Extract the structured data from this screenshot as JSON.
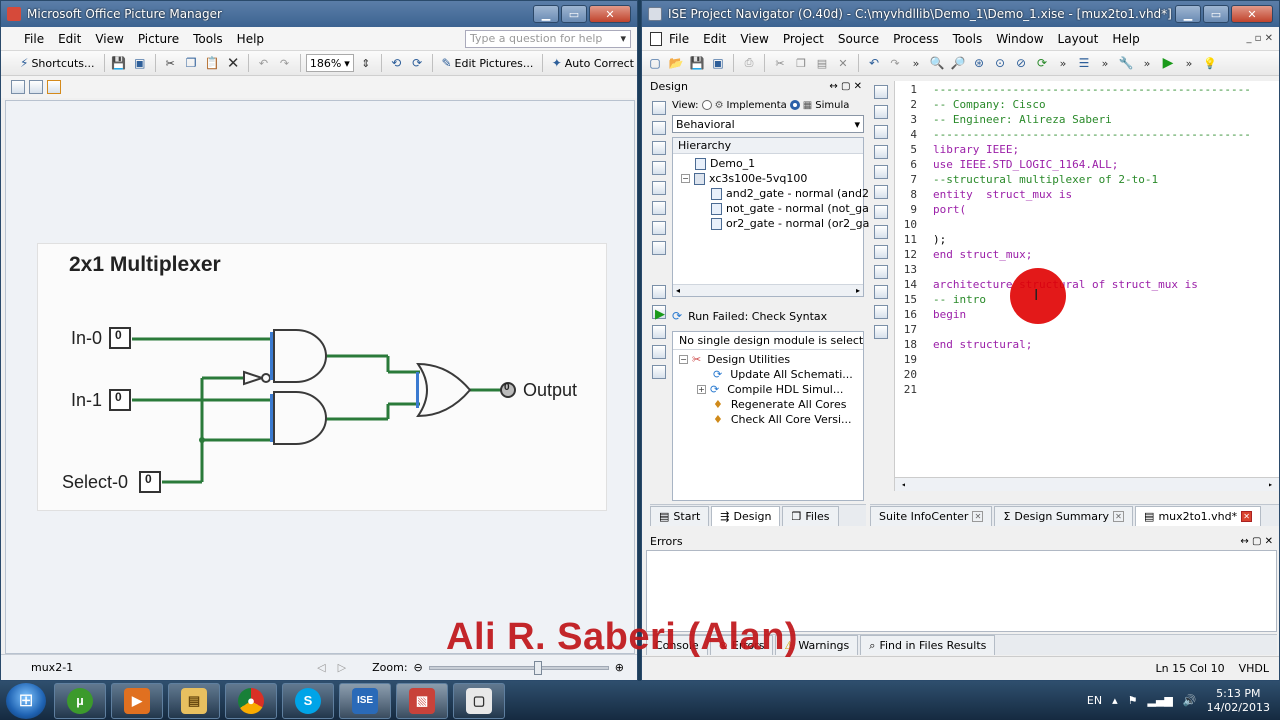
{
  "picture_manager": {
    "title": "Microsoft Office Picture Manager",
    "menu": [
      "File",
      "Edit",
      "View",
      "Picture",
      "Tools",
      "Help"
    ],
    "ask_placeholder": "Type a question for help",
    "toolbar": {
      "shortcuts": "Shortcuts...",
      "zoom": "186%",
      "edit_pictures": "Edit Pictures...",
      "auto_correct": "Auto Correct"
    },
    "image": {
      "title": "2x1 Multiplexer",
      "inputs": [
        "In-0",
        "In-1",
        "Select-0"
      ],
      "output": "Output",
      "pin_marker": "0"
    },
    "status": {
      "filename": "mux2-1",
      "zoom_label": "Zoom:"
    }
  },
  "ise": {
    "title": "ISE Project Navigator (O.40d) - C:\\myvhdllib\\Demo_1\\Demo_1.xise - [mux2to1.vhd*]",
    "menu": [
      "File",
      "Edit",
      "View",
      "Project",
      "Source",
      "Process",
      "Tools",
      "Window",
      "Layout",
      "Help"
    ],
    "design_panel": {
      "header": "Design",
      "view_label": "View:",
      "view_impl": "Implementa",
      "view_sim": "Simula",
      "behavioral": "Behavioral",
      "hierarchy_label": "Hierarchy",
      "tree": [
        {
          "label": "Demo_1",
          "indent": 1
        },
        {
          "label": "xc3s100e-5vq100",
          "indent": 0
        },
        {
          "label": "and2_gate - normal (and2",
          "indent": 2
        },
        {
          "label": "not_gate - normal (not_ga",
          "indent": 2
        },
        {
          "label": "or2_gate - normal (or2_ga",
          "indent": 2
        }
      ]
    },
    "process_panel": {
      "run_status": "Run Failed: Check Syntax",
      "none_selected": "No single design module is selected",
      "items": [
        {
          "label": "Design Utilities",
          "indent": 0
        },
        {
          "label": "Update All Schemati...",
          "indent": 1
        },
        {
          "label": "Compile HDL Simul...",
          "indent": 1
        },
        {
          "label": "Regenerate All Cores",
          "indent": 1
        },
        {
          "label": "Check All Core Versi...",
          "indent": 1
        }
      ]
    },
    "code_lines": [
      {
        "n": "1",
        "t": "------------------------------------------------",
        "c": "comment"
      },
      {
        "n": "2",
        "t": "-- Company: Cisco",
        "c": "comment"
      },
      {
        "n": "3",
        "t": "-- Engineer: Alireza Saberi",
        "c": "comment"
      },
      {
        "n": "4",
        "t": "------------------------------------------------",
        "c": "comment"
      },
      {
        "n": "5",
        "t": "library IEEE;",
        "c": "kw"
      },
      {
        "n": "6",
        "t": "use IEEE.STD_LOGIC_1164.ALL;",
        "c": "kw"
      },
      {
        "n": "7",
        "t": "--structural multiplexer of 2-to-1",
        "c": "comment"
      },
      {
        "n": "8",
        "t": "entity  struct_mux is",
        "c": "kw"
      },
      {
        "n": "9",
        "t": "port(",
        "c": "kw"
      },
      {
        "n": "10",
        "t": "",
        "c": "plain"
      },
      {
        "n": "11",
        "t": ");",
        "c": "plain"
      },
      {
        "n": "12",
        "t": "end struct_mux;",
        "c": "kw"
      },
      {
        "n": "13",
        "t": "",
        "c": "plain"
      },
      {
        "n": "14",
        "t": "architecture structural of struct_mux is",
        "c": "kw"
      },
      {
        "n": "15",
        "t": "-- intro",
        "c": "comment"
      },
      {
        "n": "16",
        "t": "begin",
        "c": "kw"
      },
      {
        "n": "17",
        "t": "",
        "c": "plain"
      },
      {
        "n": "18",
        "t": "end structural;",
        "c": "kw"
      },
      {
        "n": "19",
        "t": "",
        "c": "plain"
      },
      {
        "n": "20",
        "t": "",
        "c": "plain"
      },
      {
        "n": "21",
        "t": "",
        "c": "plain"
      }
    ],
    "left_tabs": [
      "Start",
      "Design",
      "Files"
    ],
    "doc_tabs": [
      "Suite InfoCenter",
      "Design Summary",
      "mux2to1.vhd*"
    ],
    "errors_label": "Errors",
    "bottom_tabs": [
      "Console",
      "Errors",
      "Warnings",
      "Find in Files Results"
    ],
    "status": {
      "position": "Ln 15 Col 10",
      "lang": "VHDL"
    }
  },
  "taskbar": {
    "lang": "EN",
    "time": "5:13 PM",
    "date": "14/02/2013"
  },
  "watermark": "Ali R. Saberi (Alan)"
}
